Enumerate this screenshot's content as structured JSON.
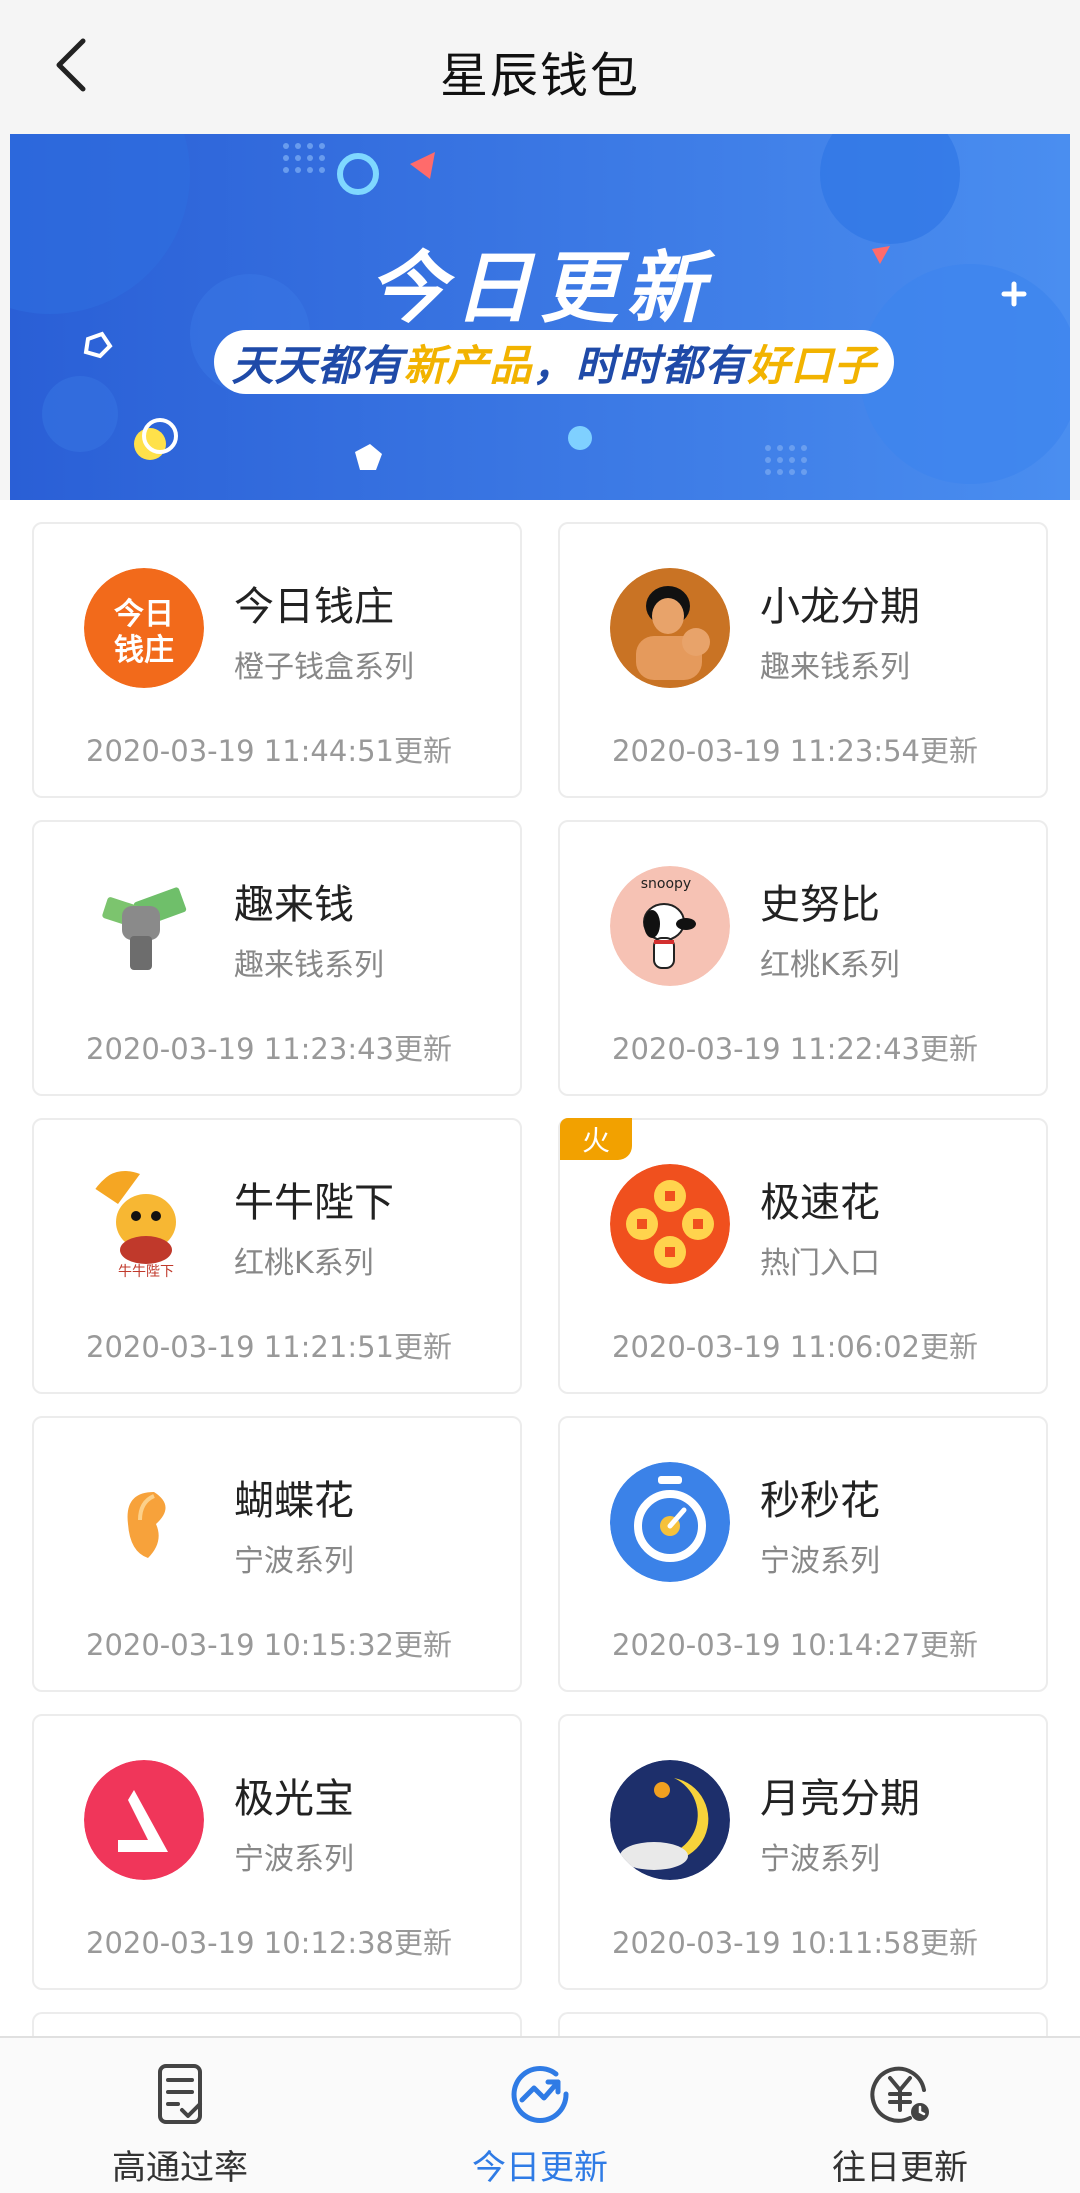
{
  "header": {
    "title": "星辰钱包"
  },
  "banner": {
    "headline": "今日更新",
    "tagline_parts": [
      "天天都有",
      "新产品",
      "，时时都有",
      "好口子"
    ]
  },
  "cards": [
    {
      "name": "今日钱庄",
      "series": "橙子钱盒系列",
      "updated": "2020-03-19 11:44:51更新",
      "logo": "jinri-qianzhuang-logo",
      "logo_text": "今日钱庄",
      "hot": false
    },
    {
      "name": "小龙分期",
      "series": "趣来钱系列",
      "updated": "2020-03-19 11:23:54更新",
      "logo": "xiaolong-fenqi-logo",
      "hot": false
    },
    {
      "name": "趣来钱",
      "series": "趣来钱系列",
      "updated": "2020-03-19 11:23:43更新",
      "logo": "fist-money-logo",
      "hot": false
    },
    {
      "name": "史努比",
      "series": "红桃K系列",
      "updated": "2020-03-19 11:22:43更新",
      "logo": "snoopy-logo",
      "logo_text": "snoopy",
      "hot": false
    },
    {
      "name": "牛牛陛下",
      "series": "红桃K系列",
      "updated": "2020-03-19 11:21:51更新",
      "logo": "niuniu-bixia-logo",
      "logo_text": "牛牛陛下",
      "hot": false
    },
    {
      "name": "极速花",
      "series": "热门入口",
      "updated": "2020-03-19 11:06:02更新",
      "logo": "jisuhua-logo",
      "hot": true,
      "hot_label": "火"
    },
    {
      "name": "蝴蝶花",
      "series": "宁波系列",
      "updated": "2020-03-19 10:15:32更新",
      "logo": "butterfly-logo",
      "hot": false
    },
    {
      "name": "秒秒花",
      "series": "宁波系列",
      "updated": "2020-03-19 10:14:27更新",
      "logo": "stopwatch-logo",
      "hot": false
    },
    {
      "name": "极光宝",
      "series": "宁波系列",
      "updated": "2020-03-19 10:12:38更新",
      "logo": "jiguangbao-logo",
      "hot": false
    },
    {
      "name": "月亮分期",
      "series": "宁波系列",
      "updated": "2020-03-19 10:11:58更新",
      "logo": "moon-logo",
      "hot": false
    }
  ],
  "tabbar": {
    "tabs": [
      {
        "label": "高通过率",
        "icon": "document-check-icon",
        "active": false
      },
      {
        "label": "今日更新",
        "icon": "trend-circle-icon",
        "active": true
      },
      {
        "label": "往日更新",
        "icon": "yen-history-icon",
        "active": false
      }
    ]
  },
  "colors": {
    "accent": "#2f7be5",
    "hot": "#f2a100",
    "banner_left": "#2a5fd6",
    "banner_right": "#4a8ef0"
  }
}
